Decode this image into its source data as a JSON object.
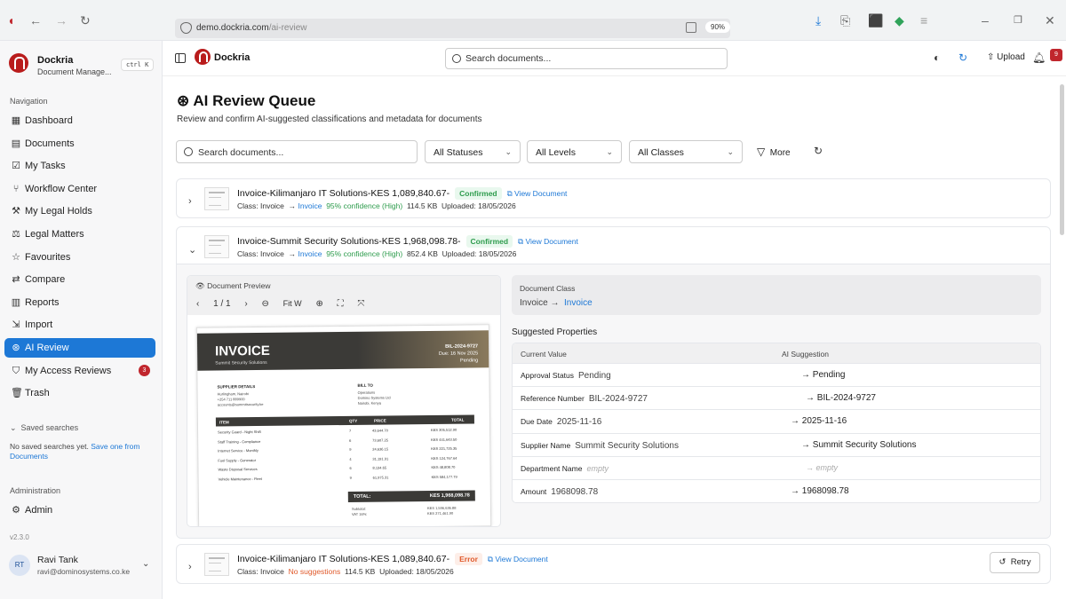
{
  "browser": {
    "url_host": "demo.dockria.com",
    "url_path": "/ai-review",
    "zoom": "90%"
  },
  "sidebar": {
    "brand_name": "Dockria",
    "brand_sub": "Document Manage...",
    "shortcut": "ctrl K",
    "nav_heading": "Navigation",
    "items": [
      {
        "label": "Dashboard",
        "icon": "dashboard-icon"
      },
      {
        "label": "Documents",
        "icon": "document-icon"
      },
      {
        "label": "My Tasks",
        "icon": "tasks-icon"
      },
      {
        "label": "Workflow Center",
        "icon": "workflow-icon"
      },
      {
        "label": "My Legal Holds",
        "icon": "gavel-icon"
      },
      {
        "label": "Legal Matters",
        "icon": "scales-icon"
      },
      {
        "label": "Favourites",
        "icon": "star-icon"
      },
      {
        "label": "Compare",
        "icon": "compare-icon"
      },
      {
        "label": "Reports",
        "icon": "chart-icon"
      },
      {
        "label": "Import",
        "icon": "import-icon"
      },
      {
        "label": "AI Review",
        "icon": "brain-icon",
        "active": true
      },
      {
        "label": "My Access Reviews",
        "icon": "shield-check-icon",
        "count": "3"
      },
      {
        "label": "Trash",
        "icon": "trash-icon"
      }
    ],
    "saved_heading": "Saved searches",
    "saved_empty": "No saved searches yet.",
    "saved_link": "Save one from Documents",
    "admin_heading": "Administration",
    "admin_label": "Admin",
    "version": "v2.3.0",
    "user": {
      "initials": "RT",
      "name": "Ravi Tank",
      "email": "ravi@dominosystems.co.ke"
    }
  },
  "topbar": {
    "brand": "Dockria",
    "search_placeholder": "Search documents...",
    "upload_label": "Upload",
    "notif_count": "9"
  },
  "page": {
    "title": "AI Review Queue",
    "subtitle": "Review and confirm AI-suggested classifications and metadata for documents",
    "search_placeholder": "Search documents...",
    "filters": {
      "status": "All Statuses",
      "level": "All Levels",
      "class": "All Classes",
      "more": "More"
    }
  },
  "documents": [
    {
      "title": "Invoice-Kilimanjaro IT Solutions-KES 1,089,840.67-",
      "status": "Confirmed",
      "view": "View Document",
      "class_label": "Class: Invoice",
      "arrow": "→",
      "suggested": "Invoice",
      "confidence": "95% confidence (High)",
      "size": "114.5 KB",
      "uploaded": "Uploaded: 18/05/2026"
    },
    {
      "title": "Invoice-Summit Security Solutions-KES 1,968,098.78-",
      "status": "Confirmed",
      "view": "View Document",
      "class_label": "Class: Invoice",
      "arrow": "→",
      "suggested": "Invoice",
      "confidence": "95% confidence (High)",
      "size": "852.4 KB",
      "uploaded": "Uploaded: 18/05/2026"
    },
    {
      "title": "Invoice-Kilimanjaro IT Solutions-KES 1,089,840.67-",
      "status": "Error",
      "view": "View Document",
      "class_label": "Class: Invoice",
      "no_suggestions": "No suggestions",
      "size": "114.5 KB",
      "uploaded": "Uploaded: 18/05/2026",
      "retry": "Retry"
    }
  ],
  "preview": {
    "label": "Document Preview",
    "page": "1 / 1",
    "fit": "Fit W",
    "invoice": {
      "title": "INVOICE",
      "company": "Summit Security Solutions",
      "number": "BIL-2024-9727",
      "due": "Due: 16 Nov 2025",
      "status": "Pending",
      "supplier_label": "SUPPLIER DETAILS",
      "supplier_lines": "Hurlingham, Nairobi\n+254 711 889900\naccounts@summitsecurity.ke",
      "billto_label": "BILL TO",
      "billto_lines": "Operations\nDomino Systems Ltd\nNairobi, Kenya",
      "col_item": "ITEM",
      "col_qty": "QTY",
      "col_price": "PRICE",
      "col_total": "TOTAL",
      "rows": [
        {
          "item": "Security Guard - Night Shift",
          "qty": "7",
          "price": "43,644.70",
          "total": "KES 305,512.90"
        },
        {
          "item": "Staff Training - Compliance",
          "qty": "6",
          "price": "73,607.25",
          "total": "KES 441,643.50"
        },
        {
          "item": "Internet Service - Monthly",
          "qty": "9",
          "price": "24,636.15",
          "total": "KES 221,725.35"
        },
        {
          "item": "Fuel Supply - Generator",
          "qty": "4",
          "price": "31,191.91",
          "total": "KES 124,767.64"
        },
        {
          "item": "Waste Disposal Services",
          "qty": "6",
          "price": "8,134.65",
          "total": "KES 48,808.70"
        },
        {
          "item": "Vehicle Maintenance - Fleet",
          "qty": "9",
          "price": "61,975.31",
          "total": "KES 584,177.79"
        }
      ],
      "total_label": "TOTAL:",
      "total_value": "KES 1,968,098.78",
      "subtotal_label": "Subtotal:",
      "subtotal_value": "KES 1,596,636.88",
      "vat_label": "VAT 16%:",
      "vat_value": "KES 271,461.90"
    }
  },
  "classification": {
    "label": "Document Class",
    "current": "Invoice",
    "arrow": "→",
    "suggested": "Invoice"
  },
  "properties": {
    "heading": "Suggested Properties",
    "col_current": "Current Value",
    "col_ai": "AI Suggestion",
    "rows": [
      {
        "name": "Approval Status",
        "current": "Pending",
        "suggestion": "→ Pending"
      },
      {
        "name": "Reference Number",
        "current": "BIL-2024-9727",
        "suggestion": "→ BIL-2024-9727"
      },
      {
        "name": "Due Date",
        "current": "2025-11-16",
        "suggestion": "→ 2025-11-16"
      },
      {
        "name": "Supplier Name",
        "current": "Summit Security Solutions",
        "suggestion": "→ Summit Security Solutions"
      },
      {
        "name": "Department Name",
        "current": "empty",
        "suggestion": "→ empty"
      },
      {
        "name": "Amount",
        "current": "1968098.78",
        "suggestion": "→ 1968098.78"
      }
    ]
  }
}
